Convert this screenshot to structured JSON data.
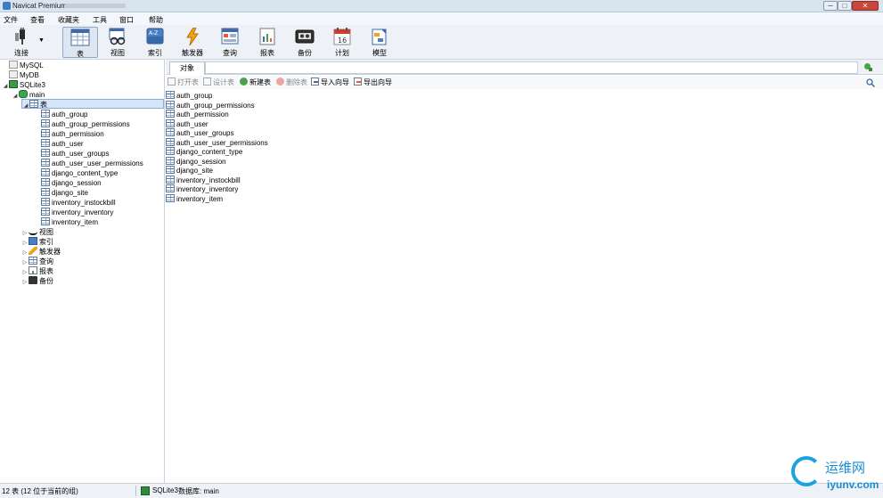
{
  "window": {
    "title": "Navicat Premium",
    "min_glyph": "─",
    "max_glyph": "□",
    "close_glyph": "✕"
  },
  "menu": [
    "文件",
    "查看",
    "收藏夹",
    "工具",
    "窗口",
    "帮助"
  ],
  "toolbar": {
    "connect": "连接",
    "table": "表",
    "view": "视图",
    "index": "索引",
    "trigger": "触发器",
    "query": "查询",
    "report": "报表",
    "backup": "备份",
    "schedule": "计划",
    "model": "模型"
  },
  "tree": {
    "connections": [
      "MySQL",
      "MyDB",
      "SQLite3"
    ],
    "database": "main",
    "tables_node": "表",
    "tables": [
      "auth_group",
      "auth_group_permissions",
      "auth_permission",
      "auth_user",
      "auth_user_groups",
      "auth_user_user_permissions",
      "django_content_type",
      "django_session",
      "django_site",
      "inventory_instockbill",
      "inventory_inventory",
      "inventory_item"
    ],
    "other_nodes": [
      "视图",
      "索引",
      "触发器",
      "查询",
      "报表",
      "备份"
    ]
  },
  "tabs": {
    "objects": "对象"
  },
  "object_toolbar": {
    "open": "打开表",
    "design": "设计表",
    "new": "新建表",
    "delete": "删除表",
    "import": "导入向导",
    "export": "导出向导"
  },
  "objects": [
    "auth_group",
    "auth_group_permissions",
    "auth_permission",
    "auth_user",
    "auth_user_groups",
    "auth_user_user_permissions",
    "django_content_type",
    "django_session",
    "django_site",
    "inventory_instockbill",
    "inventory_inventory",
    "inventory_item"
  ],
  "status": {
    "count": "12 表 (12 位于当前的组)",
    "connection": "SQLite3",
    "database": "数据库: main"
  },
  "watermark": {
    "cn": "运维网",
    "en": "iyunv.com"
  }
}
